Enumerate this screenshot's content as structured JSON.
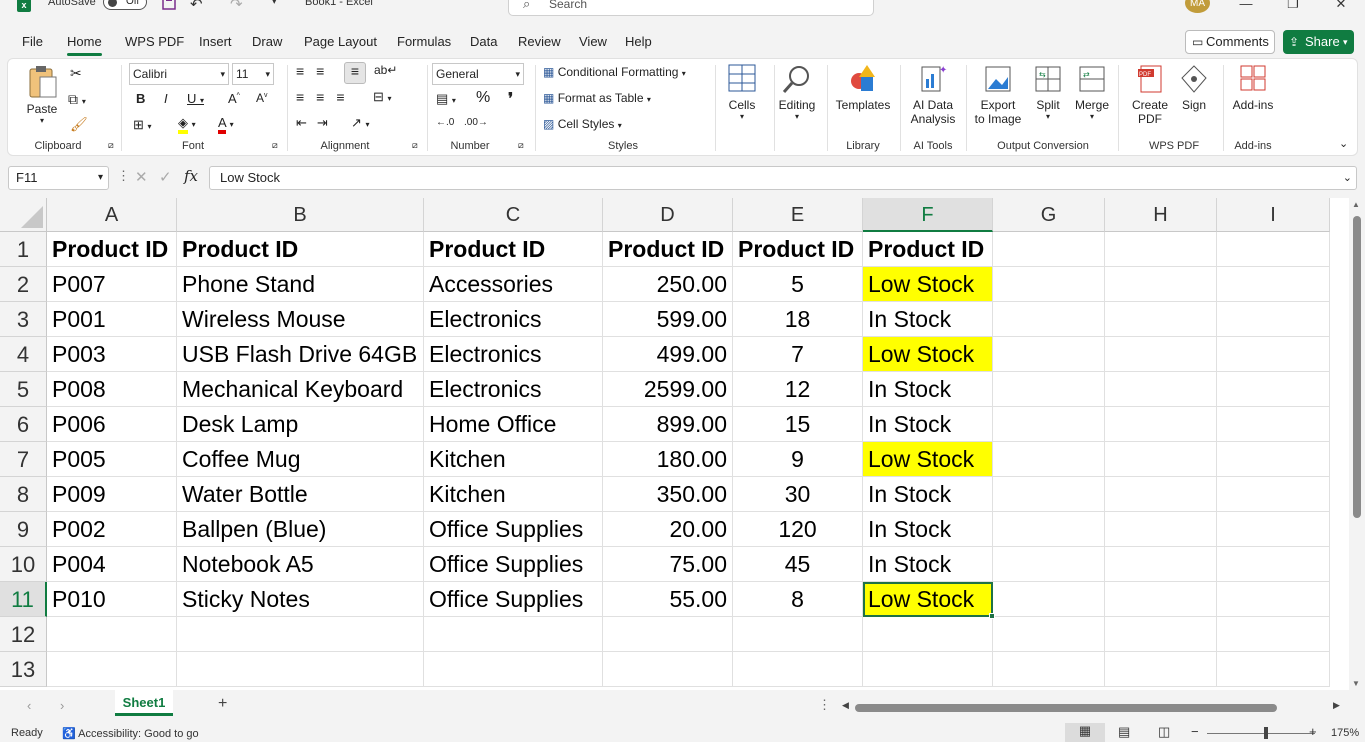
{
  "titlebar": {
    "autosave_label": "AutoSave",
    "autosave_state": "Off",
    "doc_title": "Book1  -  Excel",
    "search_placeholder": "Search",
    "user_initials": "MA"
  },
  "tabs": [
    "File",
    "Home",
    "WPS PDF",
    "Insert",
    "Draw",
    "Page Layout",
    "Formulas",
    "Data",
    "Review",
    "View",
    "Help"
  ],
  "active_tab": "Home",
  "buttons": {
    "comments": "Comments",
    "share": "Share"
  },
  "ribbon": {
    "clipboard": {
      "paste": "Paste",
      "label": "Clipboard"
    },
    "font": {
      "name": "Calibri",
      "size": "11",
      "label": "Font"
    },
    "alignment": {
      "label": "Alignment"
    },
    "number": {
      "format": "General",
      "label": "Number"
    },
    "styles": {
      "conditional": "Conditional Formatting",
      "table": "Format as Table",
      "cell_styles": "Cell Styles",
      "label": "Styles"
    },
    "cells": {
      "label": "Cells"
    },
    "editing": {
      "label": "Editing"
    },
    "library": {
      "templates": "Templates",
      "label": "Library"
    },
    "ai": {
      "analysis_1": "AI Data",
      "analysis_2": "Analysis",
      "label": "AI Tools"
    },
    "output": {
      "export_1": "Export",
      "export_2": "to Image",
      "split": "Split",
      "merge": "Merge",
      "label": "Output Conversion"
    },
    "wpspdf": {
      "create_1": "Create",
      "create_2": "PDF",
      "sign": "Sign",
      "label": "WPS PDF"
    },
    "addins": {
      "btn": "Add-ins",
      "label": "Add-ins"
    }
  },
  "formula_bar": {
    "name_box": "F11",
    "fx": "fx",
    "formula": "Low Stock"
  },
  "columns": [
    "A",
    "B",
    "C",
    "D",
    "E",
    "F",
    "G",
    "H",
    "I"
  ],
  "selected_column": "F",
  "selected_row": "11",
  "row_numbers": [
    "1",
    "2",
    "3",
    "4",
    "5",
    "6",
    "7",
    "8",
    "9",
    "10",
    "11",
    "12",
    "13"
  ],
  "rows": [
    [
      "Product ID",
      "Product ID",
      "Product ID",
      "Product ID",
      "Product ID",
      "Product ID"
    ],
    [
      "P007",
      "Phone Stand",
      "Accessories",
      "250.00",
      "5",
      "Low Stock"
    ],
    [
      "P001",
      "Wireless Mouse",
      "Electronics",
      "599.00",
      "18",
      "In Stock"
    ],
    [
      "P003",
      "USB Flash Drive 64GB",
      "Electronics",
      "499.00",
      "7",
      "Low Stock"
    ],
    [
      "P008",
      "Mechanical Keyboard",
      "Electronics",
      "2599.00",
      "12",
      "In Stock"
    ],
    [
      "P006",
      "Desk Lamp",
      "Home Office",
      "899.00",
      "15",
      "In Stock"
    ],
    [
      "P005",
      "Coffee Mug",
      "Kitchen",
      "180.00",
      "9",
      "Low Stock"
    ],
    [
      "P009",
      "Water Bottle",
      "Kitchen",
      "350.00",
      "30",
      "In Stock"
    ],
    [
      "P002",
      "Ballpen (Blue)",
      "Office Supplies",
      "20.00",
      "120",
      "In Stock"
    ],
    [
      "P004",
      "Notebook A5",
      "Office Supplies",
      "75.00",
      "45",
      "In Stock"
    ],
    [
      "P010",
      "Sticky Notes",
      "Office Supplies",
      "55.00",
      "8",
      "Low Stock"
    ]
  ],
  "highlight_color": "#ffff00",
  "accent_color": "#107c41",
  "sheet_tab": "Sheet1",
  "status": {
    "ready": "Ready",
    "accessibility": "Accessibility: Good to go",
    "zoom": "175%"
  }
}
